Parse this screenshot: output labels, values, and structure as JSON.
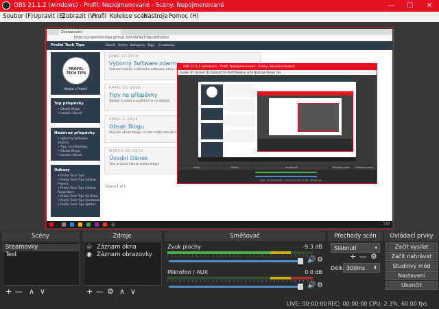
{
  "window": {
    "title": "OBS 21.1.2 (windows) - Profil: Nepojmenované - Scény: Nepojmenované",
    "minimize_glyph": "—",
    "maximize_glyph": "☐",
    "close_glyph": "✕"
  },
  "menubar": {
    "items": [
      "Soubor (F)",
      "Upravit (E)",
      "Zobrazit (V)",
      "Profil",
      "Kolekce scén",
      "Nástroje",
      "Pomoc (H)"
    ]
  },
  "preview": {
    "browser": {
      "tab_label": "Zobrazování",
      "url": "https://projecttechtips.github.io/ProfeTechTips/ddfsdfsd"
    },
    "blog": {
      "brand": "Profel Tech Tips",
      "nav": [
        "Domů",
        "Archiv",
        "Kategorie",
        "Tagy",
        "O autorovi"
      ],
      "logo_text": "PROFEL TECH TIPS",
      "card_subtitle": "Vítejte v Profeli",
      "top_posts_title": "Top příspěvky",
      "top_posts": [
        "Obsah Blogu",
        "Úvodní článek"
      ],
      "recent_title": "Nedávné příspěvky",
      "recent": [
        "Výborný Software zdarma",
        "Tipy na příspěvky",
        "Obsah Blogu",
        "Úvodní článek"
      ],
      "links_title": "Odkazy",
      "links": [
        "Profel Tech Tips",
        "Profel Tech Tips GitHub Project",
        "Profel Tech Tips GitHub Repository",
        "Profel Tech Tips YouTube",
        "Profel Tech Tips Facebook",
        "Profel Tech Tips Twitter"
      ],
      "posts": [
        {
          "date": "JUNE-11-2018",
          "title": "Výborný Software zdarma",
          "excerpt": "Seznam častěji ověřeného softwaru, který můžete..."
        },
        {
          "date": "APRIL-20-2018",
          "title": "Tipy na příspěvky",
          "excerpt": "Žádost o videa a potřební se na doteze"
        },
        {
          "date": "APRIL-1-2018",
          "title": "Obsah Blogu",
          "excerpt": "Popisán obsah blogu, co zde může čtenář očekávat..."
        },
        {
          "date": "MARCH-01-2018",
          "title": "Úvodní článek",
          "excerpt": "Toto je první článek mého blogu!"
        }
      ],
      "pager": "Strana 1 of 1"
    },
    "nested_window": {
      "title": "OBS 21.1.2 (windows) - Profil: Nepojmenované - Scény: Nepojmenované",
      "menu": "Soubor (F)   Upravit (E)   Zobrazit (V)   Profil   Kolekce scén   Nástroje   Pomoc (H)",
      "dock_headers": [
        "Scény",
        "Zdroje",
        "Směšovač",
        "Přechody scén",
        "Ovládací prvky"
      ],
      "status": "LIVE: 00:00:00     REC: 00:00:00     CPU: 2.3%, 60.00 fps"
    },
    "taskbar": {
      "clock": "5:02"
    }
  },
  "docks": {
    "scenes": {
      "header": "Scény",
      "items": [
        "Steamovky",
        "Test"
      ],
      "selected_index": 0
    },
    "sources": {
      "header": "Zdroje",
      "items": [
        {
          "label": "Záznam okna",
          "visible_icon": "eye-slashed-icon"
        },
        {
          "label": "Záznam obrazovky",
          "visible_icon": "eye-icon"
        }
      ]
    },
    "mixer": {
      "header": "Směšovač",
      "channels": [
        {
          "name": "Zvuk plochy",
          "db": "-9.3 dB",
          "volume_percent": 100,
          "meter_percent": 78
        },
        {
          "name": "Mikrofon / AUX",
          "db": "0.0 dB",
          "volume_percent": 100,
          "meter_percent": 0
        }
      ]
    },
    "transitions": {
      "header": "Přechody scén",
      "selected": "Slábnutí",
      "duration_label": "Délka",
      "duration_value": "300ms"
    },
    "controls": {
      "header": "Ovládací prvky",
      "buttons": [
        "Začít vysílat",
        "Začít nahrávat",
        "Studiový mód",
        "Nastavení",
        "Ukončit"
      ]
    },
    "toolbar_glyphs": {
      "add": "+",
      "remove": "—",
      "up": "∧",
      "down": "∨",
      "settings": "⚙"
    }
  },
  "statusbar": {
    "live": "LIVE: 00:00:00",
    "rec": "REC: 00:00:00",
    "cpu": "CPU: 2.3%, 60.00 fps"
  },
  "colors": {
    "accent_red": "#e81123",
    "panel": "#2b2b2b",
    "header": "#3b3b3b",
    "link_blue": "#2a7ab0"
  }
}
